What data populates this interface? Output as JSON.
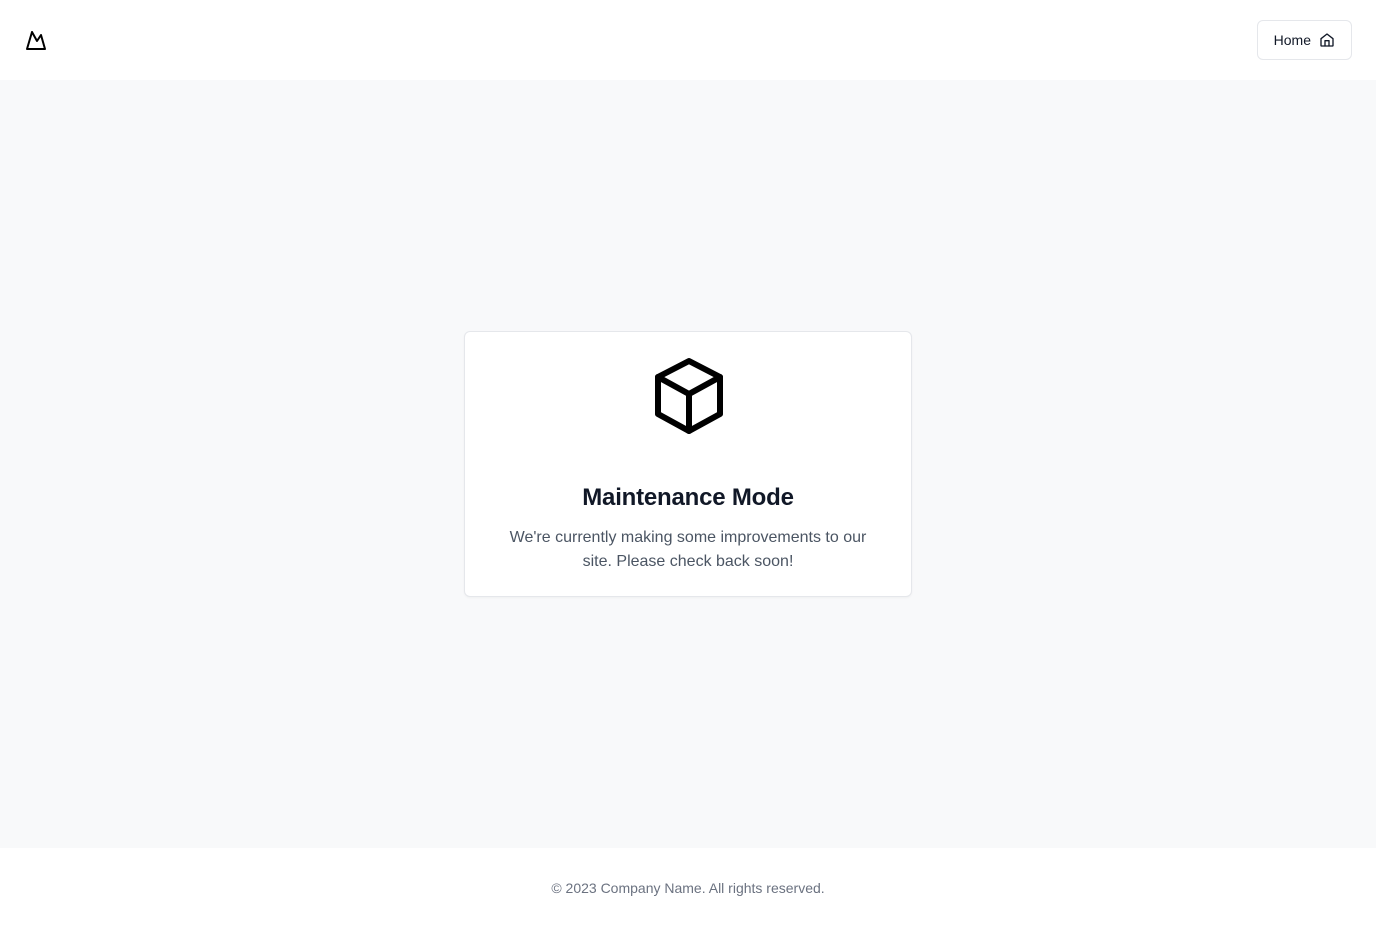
{
  "header": {
    "logo_icon": "mountain-icon",
    "home_button": {
      "label": "Home",
      "icon": "home-icon"
    }
  },
  "main": {
    "card": {
      "icon": "package-cube-icon",
      "title": "Maintenance Mode",
      "message": "We're currently making some improvements to our site. Please check back soon!"
    }
  },
  "footer": {
    "copyright": "© 2023 Company Name. All rights reserved."
  },
  "colors": {
    "page_background": "#f8f9fa",
    "header_background": "#ffffff",
    "title_text": "#111827",
    "body_text": "#4b5563",
    "muted_text": "#6b7280",
    "border": "#e5e7eb"
  }
}
